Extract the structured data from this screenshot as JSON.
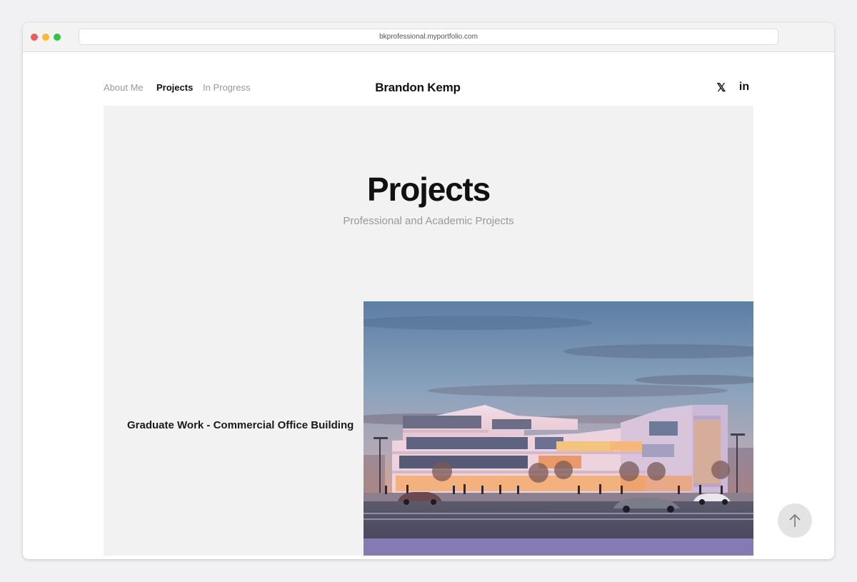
{
  "browser": {
    "url": "bkprofessional.myportfolio.com"
  },
  "nav": {
    "links": [
      {
        "label": "About Me"
      },
      {
        "label": "Projects"
      },
      {
        "label": "In Progress"
      }
    ],
    "brand": "Brandon Kemp",
    "social": [
      {
        "icon": "x-icon",
        "glyph": "𝕏"
      },
      {
        "icon": "linkedin-icon",
        "glyph": "in"
      }
    ]
  },
  "hero": {
    "title": "Projects",
    "subtitle": "Professional and Academic Projects"
  },
  "projects": [
    {
      "title": "Graduate Work - Commercial Office Building"
    }
  ],
  "back_to_top": {
    "icon": "arrow-up-icon"
  },
  "colors": {
    "page_bg": "#f1f1f3",
    "panel_bg": "#f2f2f2",
    "text_dark": "#111111",
    "text_muted": "#9a9a9a"
  }
}
